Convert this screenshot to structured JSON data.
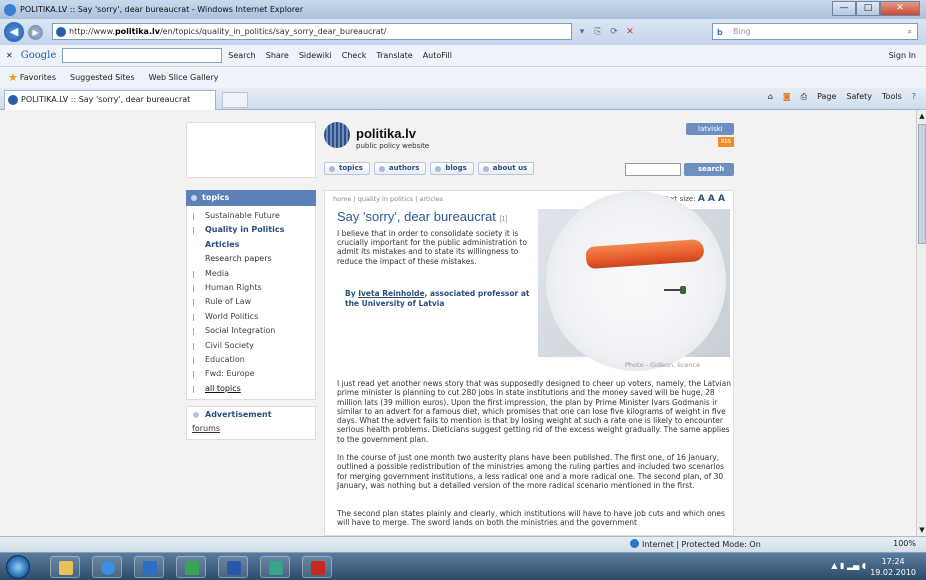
{
  "window": {
    "title": "POLITIKA.LV :: Say 'sorry', dear bureaucrat - Windows Internet Explorer",
    "min": "—",
    "max": "□",
    "close": "✕"
  },
  "address": {
    "url_prefix": "http://www.",
    "url_domain": "politika.lv",
    "url_path": "/en/topics/quality_in_politics/say_sorry_dear_bureaucrat/",
    "bing_label": "Bing",
    "bing_logo": "b",
    "back_icon": "◀",
    "forward_icon": "▶",
    "search_icon": "⌕"
  },
  "google_bar": {
    "brand": "Google",
    "search": "Search",
    "share": "Share",
    "sidewiki": "Sidewiki",
    "check": "Check",
    "translate": "Translate",
    "autofill": "AutoFill",
    "signin": "Sign In"
  },
  "favorites_bar": {
    "favorites": "Favorites",
    "suggested": "Suggested Sites",
    "webslice": "Web Slice Gallery"
  },
  "tab": {
    "title": "POLITIKA.LV :: Say 'sorry', dear bureaucrat"
  },
  "command_bar": {
    "page": "Page",
    "safety": "Safety",
    "tools": "Tools"
  },
  "site": {
    "name": "politika.lv",
    "tagline": "public policy website",
    "lang": "latviski",
    "rss": "RSS",
    "nav": [
      "topics",
      "authors",
      "blogs",
      "about us"
    ],
    "search_button": "search"
  },
  "sidebar": {
    "header": "topics",
    "items": [
      {
        "label": "Sustainable Future"
      },
      {
        "label": "Quality in Politics"
      },
      {
        "label": "Articles"
      },
      {
        "label": "Research papers"
      },
      {
        "label": "Media"
      },
      {
        "label": "Human Rights"
      },
      {
        "label": "Rule of Law"
      },
      {
        "label": "World Politics"
      },
      {
        "label": "Social Integration"
      },
      {
        "label": "Civil Society"
      },
      {
        "label": "Education"
      },
      {
        "label": "Fwd: Europe"
      },
      {
        "label": "all topics"
      }
    ],
    "ad_header": "Advertisement",
    "forums": "forums"
  },
  "article": {
    "breadcrumb": "home | quality in politics | articles",
    "text_size_label": "Text size:",
    "text_size_a": "A A A",
    "title": "Say 'sorry', dear bureaucrat",
    "title_count": "[1]",
    "lead": "I believe that in order to consolidate society it is crucially important for the public administration to admit its mistakes and to state its willingness to reduce the impact of these mistakes.",
    "byline_by": "By ",
    "byline_author": "Iveta Reinholde",
    "byline_role": ", associated professor at the University of Latvia",
    "photo_credit": "Photo - Gideon, licence",
    "p1": "I just read yet another news story that was supposedly designed to cheer up voters, namely, the Latvian prime minister is planning to cut 280 jobs in state institutions and the money saved will be huge, 28 million lats (39 million euros). Upon the first impression, the plan by Prime Minister Ivars Godmanis ir similar to an advert for a famous diet, which promises that one can lose five kilograms of weight in five days. What the advert fails to mention is that by losing weight at such a rate one is likely to encounter serious health problems. Dieticians suggest getting rid of the excess weight gradually. The same applies to the government plan.",
    "p2": "In the course of just one month two austerity plans have been published. The first one, of 16 January, outlined a possible redistribution of the ministries among the ruling parties and included two scenarios for merging government institutions, a less radical one and a more radical one. The second plan, of 30 January, was nothing but a detailed version of the more radical scenario mentioned in the first.",
    "p3": "The second plan states plainly and clearly, which institutions will have to have job cuts and which ones will have to merge. The sword lands on both the ministries and the government"
  },
  "status": {
    "zone": "Internet | Protected Mode: On",
    "zoom": "100%"
  },
  "taskbar": {
    "time": "17:24",
    "date": "19.02.2010"
  }
}
